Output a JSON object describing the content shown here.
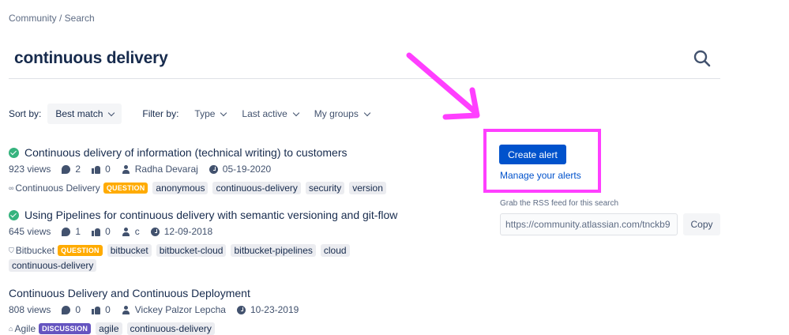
{
  "breadcrumb": "Community / Search",
  "search": {
    "query": "continuous delivery"
  },
  "sort": {
    "label": "Sort by:",
    "value": "Best match"
  },
  "filter": {
    "label": "Filter by:",
    "items": [
      "Type",
      "Last active",
      "My groups"
    ]
  },
  "results": [
    {
      "title": "Continuous delivery of information (technical writing) to customers",
      "resolved": true,
      "views": "923 views",
      "comments": "2",
      "likes": "0",
      "author": "Radha Devaraj",
      "date": "05-19-2020",
      "space": "Continuous Delivery",
      "type": "QUESTION",
      "tags": [
        "anonymous",
        "continuous-delivery",
        "security",
        "version"
      ]
    },
    {
      "title": "Using Pipelines for continuous delivery with semantic versioning and git-flow",
      "resolved": true,
      "views": "645 views",
      "comments": "1",
      "likes": "0",
      "author": "c",
      "date": "12-09-2018",
      "space": "Bitbucket",
      "type": "QUESTION",
      "tags": [
        "bitbucket",
        "bitbucket-cloud",
        "bitbucket-pipelines",
        "cloud",
        "continuous-delivery"
      ]
    },
    {
      "title": "Continuous Delivery and Continuous Deployment",
      "resolved": false,
      "views": "808 views",
      "comments": "0",
      "likes": "0",
      "author": "Vickey Palzor Lepcha",
      "date": "10-23-2019",
      "space": "Agile",
      "type": "DISCUSSION",
      "tags": [
        "agile",
        "continuous-delivery"
      ]
    }
  ],
  "sidebar": {
    "create_alert": "Create alert",
    "manage_alerts": "Manage your alerts",
    "rss_label": "Grab the RSS feed for this search",
    "rss_url": "https://community.atlassian.com/tnckb9",
    "copy": "Copy"
  },
  "colors": {
    "accent": "#0052cc",
    "annotation": "#ff3fff",
    "resolved": "#36b37e",
    "question": "#ffab00",
    "discussion": "#6554c0"
  }
}
